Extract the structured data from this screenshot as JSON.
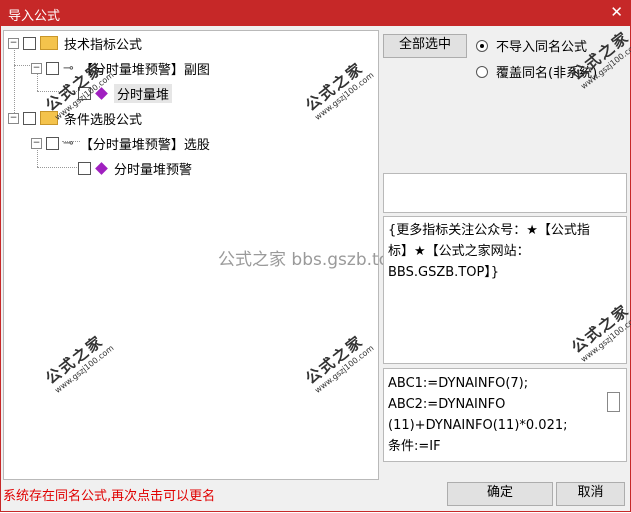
{
  "window": {
    "title": "导入公式",
    "close_glyph": "✕"
  },
  "tree": {
    "groups": [
      {
        "label": "技术指标公式",
        "children": [
          {
            "label": "【分时量堆预警】副图",
            "leaf": "分时量堆"
          }
        ]
      },
      {
        "label": "条件选股公式",
        "children": [
          {
            "label": "【分时量堆预警】选股",
            "leaf": "分时量堆预警"
          }
        ]
      }
    ]
  },
  "options": {
    "select_all_label": "全部选中",
    "radio_1_label": "不导入同名公式",
    "radio_2_label": "覆盖同名(非系统)"
  },
  "description_text": "{更多指标关注公众号：★【公式指标】★【公式之家网站：BBS.GSZB.TOP】}",
  "code_text": "ABC1:=DYNAINFO(7);\nABC2:=DYNAINFO(11)+DYNAINFO(11)*0.021;\n条件:=IF",
  "watermark": {
    "text_big": "公式之家",
    "text_small": "www.gszj100.com",
    "center_text": "公式之家 bbs.gszb.top"
  },
  "status_text": "系统存在同名公式,再次点击可以更名",
  "buttons": {
    "ok_label": "确定",
    "cancel_label": "取消"
  }
}
